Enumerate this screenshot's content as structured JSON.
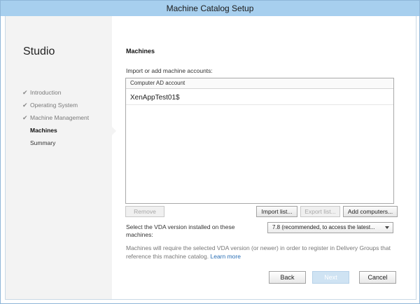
{
  "window": {
    "title": "Machine Catalog Setup"
  },
  "sidebar": {
    "brand": "Studio",
    "steps": [
      {
        "label": "Introduction",
        "done": true
      },
      {
        "label": "Operating System",
        "done": true
      },
      {
        "label": "Machine Management",
        "done": true
      },
      {
        "label": "Machines",
        "current": true
      },
      {
        "label": "Summary"
      }
    ]
  },
  "main": {
    "title": "Machines",
    "import_label": "Import or add machine accounts:",
    "table": {
      "column": "Computer AD account",
      "rows": [
        "XenAppTest01$"
      ]
    },
    "buttons": {
      "remove": "Remove",
      "import_list": "Import list...",
      "export_list": "Export list...",
      "add_computers": "Add computers..."
    },
    "vda": {
      "label": "Select the VDA version installed on these machines:",
      "selected": "7.8 (recommended, to access the latest..."
    },
    "note": {
      "text": "Machines will require the selected VDA version (or newer) in order to register in Delivery Groups that reference this machine catalog.",
      "link": "Learn more"
    }
  },
  "footer": {
    "back": "Back",
    "next": "Next",
    "cancel": "Cancel"
  },
  "colors": {
    "titlebar": "#a7cfee",
    "sidebar": "#f3f3f3",
    "link": "#2a6fb5"
  }
}
